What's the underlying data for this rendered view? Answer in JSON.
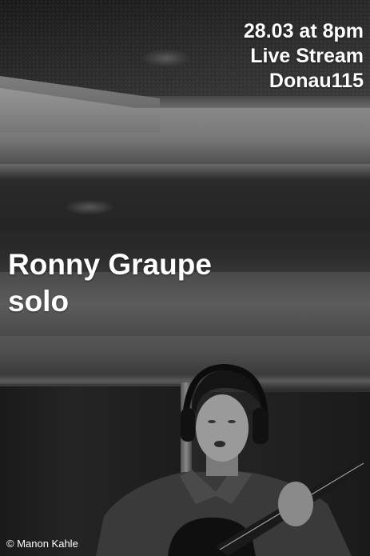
{
  "poster": {
    "event_date_time": "28.03 at 8pm",
    "event_type": "Live Stream",
    "venue": "Donau115",
    "artist_name": "Ronny Graupe",
    "artist_format": "solo",
    "photo_credit": "© Manon Kahle"
  },
  "colors": {
    "text": "#ffffff",
    "tone": "black-and-white"
  }
}
